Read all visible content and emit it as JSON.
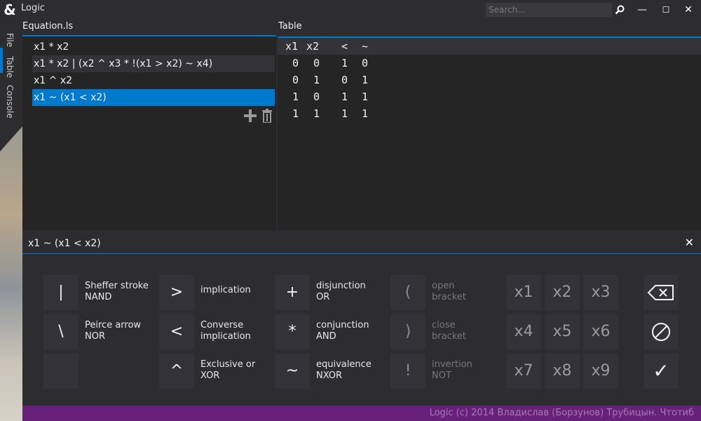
{
  "app": {
    "logo": "&",
    "title": "Logic"
  },
  "search": {
    "placeholder": "Search..."
  },
  "window_controls": {
    "search_icon": "magnifier-icon",
    "minimize": "—",
    "maximize": "☐",
    "close": "✕"
  },
  "side_tabs": [
    "File",
    "Table",
    "Console"
  ],
  "equation_panel": {
    "header": "Equation.ls",
    "items": [
      "x1 * x2",
      "x1 * x2 | (x2 ^ x3 * !(x1 > x2) ~ x4)",
      "x1 ^ x2",
      "x1 ~ (x1 < x2)"
    ],
    "selected_index": 3,
    "add_icon": "plus-icon",
    "delete_icon": "trash-icon"
  },
  "table_panel": {
    "header": "Table",
    "columns": [
      "x1",
      "x2",
      "<",
      "~"
    ],
    "rows": [
      [
        "0",
        "0",
        "1",
        "0"
      ],
      [
        "0",
        "1",
        "0",
        "1"
      ],
      [
        "1",
        "0",
        "1",
        "1"
      ],
      [
        "1",
        "1",
        "1",
        "1"
      ]
    ]
  },
  "current_equation": {
    "text": "x1 ~ (x1 < x2)",
    "clear": "✕"
  },
  "keypad": {
    "ops": [
      {
        "symbol": "|",
        "name": "Sheffer stroke",
        "alt": "NAND"
      },
      {
        "symbol": "\\",
        "name": "Peirce arrow",
        "alt": "NOR"
      },
      {
        "symbol": ">",
        "name": "implication",
        "alt": ""
      },
      {
        "symbol": "<",
        "name": "Converse",
        "alt": "implication"
      },
      {
        "symbol": "^",
        "name": "Exclusive or",
        "alt": "XOR"
      },
      {
        "symbol": "+",
        "name": "disjunction",
        "alt": "OR"
      },
      {
        "symbol": "*",
        "name": "conjunction",
        "alt": "AND"
      },
      {
        "symbol": "~",
        "name": "equivalence",
        "alt": "NXOR"
      },
      {
        "symbol": "(",
        "name": "open",
        "alt": "bracket"
      },
      {
        "symbol": ")",
        "name": "close",
        "alt": "bracket"
      },
      {
        "symbol": "!",
        "name": "invertion",
        "alt": "NOT"
      }
    ],
    "variables": [
      "x1",
      "x2",
      "x3",
      "x4",
      "x5",
      "x6",
      "x7",
      "x8",
      "x9"
    ],
    "actions": {
      "backspace_icon": "backspace-icon",
      "clear_icon": "clear-circle-icon",
      "confirm": "✓"
    }
  },
  "status_bar": {
    "text": "Logic (c) 2014 Владислав (Борзунов) Трубицын. Чтотиб"
  },
  "colors": {
    "accent": "#007acc",
    "status_bar": "#68217a",
    "background": "#2d2d30"
  }
}
